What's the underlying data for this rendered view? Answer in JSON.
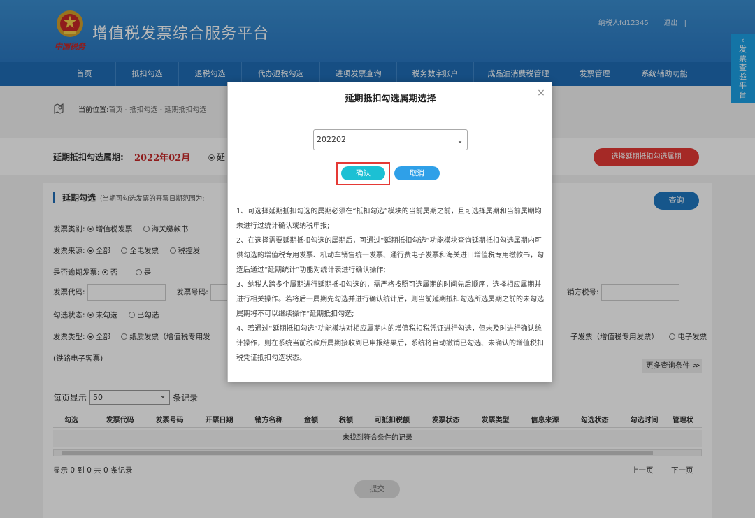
{
  "header": {
    "brand": "中国税务",
    "site_title": "增值税发票综合服务平台",
    "user_label": "纳税人fd12345",
    "separator": "|",
    "logout": "退出"
  },
  "nav": [
    "首页",
    "抵扣勾选",
    "退税勾选",
    "代办退税勾选",
    "进项发票查询",
    "税务数字账户",
    "成品油消费税管理",
    "发票管理",
    "系统辅助功能"
  ],
  "side_tab": [
    "发",
    "票",
    "查",
    "验",
    "平",
    "台"
  ],
  "breadcrumb": {
    "label": "当前位置:",
    "path": "首页 - 抵扣勾选 - 延期抵扣勾选"
  },
  "period_bar": {
    "label": "延期抵扣勾选属期:",
    "value": "2022年02月",
    "radio_text": "延",
    "select_btn": "选择延期抵扣勾选属期"
  },
  "query": {
    "title": "延期勾选",
    "subtitle": "(当期可勾选发票的开票日期范围为:",
    "button": "查询",
    "invoice_category_label": "发票类别:",
    "invoice_category_opts": [
      "增值税发票",
      "海关缴款书"
    ],
    "source_label": "发票来源:",
    "source_opts": [
      "全部",
      "全电发票",
      "税控发"
    ],
    "overdue_label": "是否逾期发票:",
    "overdue_opts": [
      "否",
      "是"
    ],
    "code_label": "发票代码:",
    "number_label": "发票号码:",
    "seller_tax_label": "销方税号:",
    "status_label": "勾选状态:",
    "status_opts": [
      "未勾选",
      "已勾选"
    ],
    "type_label": "发票类型:",
    "type_opts": [
      "全部",
      "纸质发票（增值税专用发"
    ],
    "type_right_text": "子发票（增值税专用发票）",
    "type_right_opt": "电子发票",
    "type_cont": "(铁路电子客票)",
    "more_conditions": "更多查询条件 ≫"
  },
  "list": {
    "per_page_label": "每页显示",
    "per_page_value": "50",
    "per_page_suffix": "条记录",
    "columns": [
      "勾选",
      "发票代码",
      "发票号码",
      "开票日期",
      "销方名称",
      "金额",
      "税额",
      "可抵扣税额",
      "发票状态",
      "发票类型",
      "信息来源",
      "勾选状态",
      "勾选时间",
      "管理状"
    ],
    "empty_text": "未找到符合条件的记录",
    "page_info": "显示 0 到 0 共 0 条记录",
    "prev": "上一页",
    "next": "下一页",
    "submit": "提交"
  },
  "modal": {
    "title": "延期抵扣勾选属期选择",
    "close": "×",
    "selected_period": "202202",
    "confirm": "确认",
    "cancel": "取消",
    "notes": [
      "1、可选择延期抵扣勾选的属期必须在“抵扣勾选”模块的当前属期之前，且可选择属期和当前属期均未进行过统计确认或纳税申报;",
      "2、在选择需要延期抵扣勾选的属期后，可通过“延期抵扣勾选”功能模块查询延期抵扣勾选属期内可供勾选的增值税专用发票、机动车销售统一发票、通行费电子发票和海关进口增值税专用缴款书，勾选后通过“延期统计”功能对统计表进行确认操作;",
      "3、纳税人跨多个属期进行延期抵扣勾选的，需严格按照可选属期的时间先后顺序，选择相应属期并进行相关操作。若将后一属期先勾选并进行确认统计后，则当前延期抵扣勾选所选属期之前的未勾选属期将不可以继续操作“延期抵扣勾选;",
      "4、若通过“延期抵扣勾选”功能模块对相应属期内的增值税扣税凭证进行勾选，但未及时进行确认统计操作，则在系统当前税款所属期接收到已申报结果后，系统将自动撤销已勾选、未确认的增值税扣税凭证抵扣勾选状态。"
    ]
  },
  "colors": {
    "header_blue": "#2a78c2",
    "nav_blue": "#1f6db6",
    "accent_red": "#e53935",
    "confirm_cyan": "#1cc0d4",
    "cancel_blue": "#2fa0e8",
    "side_tab": "#1da1e6"
  }
}
